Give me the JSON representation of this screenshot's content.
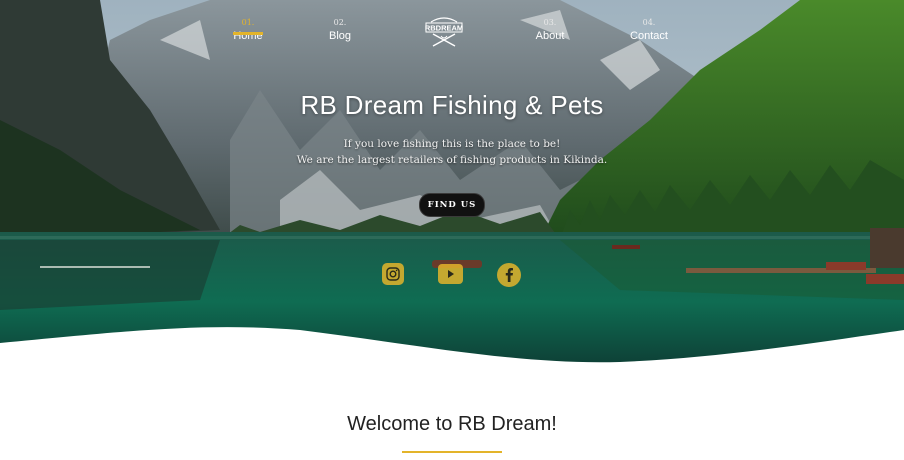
{
  "nav": {
    "items": [
      {
        "num": "01.",
        "label": "Home"
      },
      {
        "num": "02.",
        "label": "Blog"
      },
      {
        "num": "03.",
        "label": "About"
      },
      {
        "num": "04.",
        "label": "Contact"
      }
    ],
    "active_index": 0
  },
  "logo": {
    "text": "RBDREAM"
  },
  "hero": {
    "title": "RB Dream Fishing & Pets",
    "subtitle_line1": "If you love fishing this is the place to be!",
    "subtitle_line2": "We are the largest retailers of fishing products in Kikinda.",
    "button": "FIND US"
  },
  "social": [
    {
      "icon": "instagram-icon"
    },
    {
      "icon": "youtube-icon"
    },
    {
      "icon": "facebook-icon"
    }
  ],
  "welcome": {
    "heading": "Welcome to RB Dream!"
  },
  "colors": {
    "accent": "#e3b42a"
  }
}
